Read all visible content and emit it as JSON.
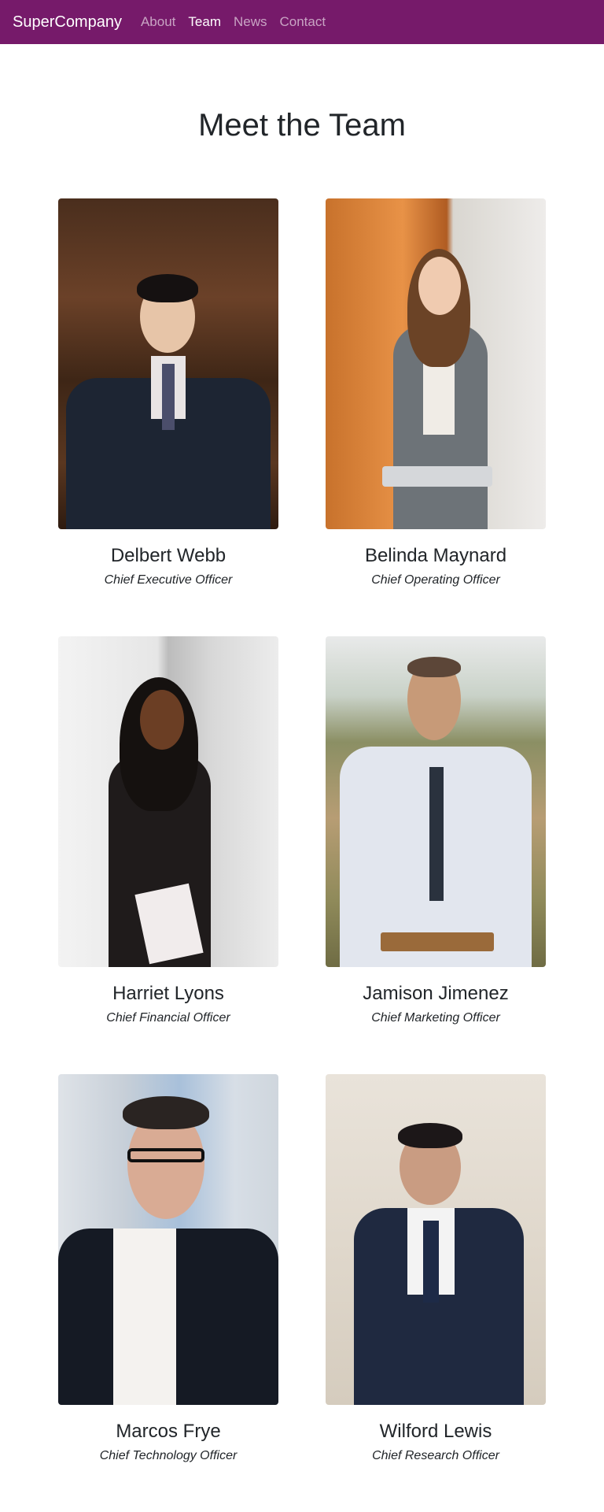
{
  "navbar": {
    "brand": "SuperCompany",
    "links": [
      {
        "label": "About",
        "active": false
      },
      {
        "label": "Team",
        "active": true
      },
      {
        "label": "News",
        "active": false
      },
      {
        "label": "Contact",
        "active": false
      }
    ],
    "bg_color": "#761a6a"
  },
  "page": {
    "title": "Meet the Team"
  },
  "team": [
    {
      "name": "Delbert Webb",
      "role": "Chief Executive Officer"
    },
    {
      "name": "Belinda Maynard",
      "role": "Chief Operating Officer"
    },
    {
      "name": "Harriet Lyons",
      "role": "Chief Financial Officer"
    },
    {
      "name": "Jamison Jimenez",
      "role": "Chief Marketing Officer"
    },
    {
      "name": "Marcos Frye",
      "role": "Chief Technology Officer"
    },
    {
      "name": "Wilford Lewis",
      "role": "Chief Research Officer"
    }
  ]
}
